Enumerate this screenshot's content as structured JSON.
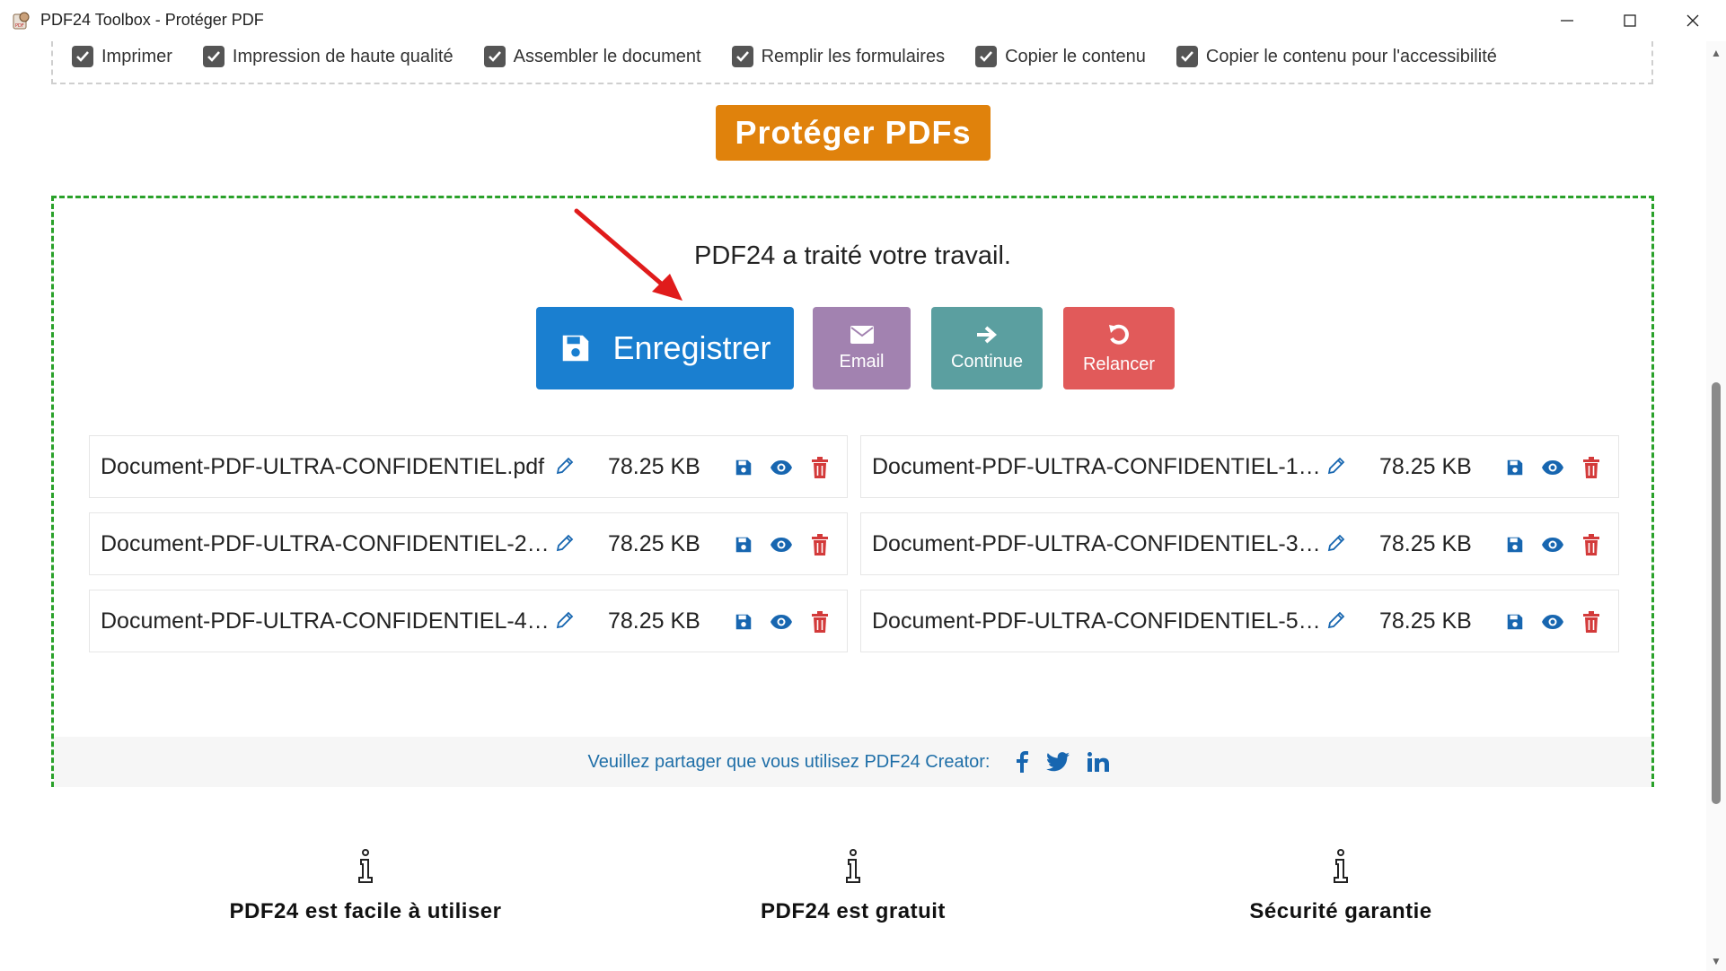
{
  "window": {
    "title": "PDF24 Toolbox - Protéger PDF",
    "icons": {
      "app": "pdf24-app-icon",
      "minimize": "minimize-icon",
      "maximize": "maximize-icon",
      "close": "close-icon"
    }
  },
  "permissions": [
    {
      "label": "Imprimer",
      "checked": true
    },
    {
      "label": "Impression de haute qualité",
      "checked": true
    },
    {
      "label": "Assembler le document",
      "checked": true
    },
    {
      "label": "Remplir les formulaires",
      "checked": true
    },
    {
      "label": "Copier le contenu",
      "checked": true
    },
    {
      "label": "Copier le contenu pour l'accessibilité",
      "checked": true
    }
  ],
  "protect_button": {
    "label": "Protéger PDFs",
    "color": "#e0820c"
  },
  "result": {
    "message": "PDF24 a traité votre travail.",
    "actions": {
      "save": {
        "label": "Enregistrer",
        "icon": "floppy-disk-icon",
        "color": "#1a7fd0"
      },
      "email": {
        "label": "Email",
        "icon": "envelope-icon",
        "color": "#a282b0"
      },
      "continue": {
        "label": "Continue",
        "icon": "arrow-right-icon",
        "color": "#5b9fa0"
      },
      "relancer": {
        "label": "Relancer",
        "icon": "undo-icon",
        "color": "#e15a5a"
      }
    },
    "files": [
      {
        "name": "Document-PDF-ULTRA-CONFIDENTIEL.pdf",
        "size": "78.25 KB"
      },
      {
        "name": "Document-PDF-ULTRA-CONFIDENTIEL-1…",
        "size": "78.25 KB"
      },
      {
        "name": "Document-PDF-ULTRA-CONFIDENTIEL-2…",
        "size": "78.25 KB"
      },
      {
        "name": "Document-PDF-ULTRA-CONFIDENTIEL-3…",
        "size": "78.25 KB"
      },
      {
        "name": "Document-PDF-ULTRA-CONFIDENTIEL-4…",
        "size": "78.25 KB"
      },
      {
        "name": "Document-PDF-ULTRA-CONFIDENTIEL-5…",
        "size": "78.25 KB"
      }
    ],
    "file_icons": {
      "rename": "pencil-icon",
      "save": "floppy-disk-icon",
      "preview": "eye-icon",
      "delete": "trash-icon"
    },
    "share": {
      "text": "Veuillez partager que vous utilisez PDF24 Creator:",
      "networks": [
        "facebook-icon",
        "twitter-icon",
        "linkedin-icon"
      ]
    }
  },
  "features": [
    {
      "title": "PDF24 est facile à utiliser",
      "icon": "info-icon"
    },
    {
      "title": "PDF24 est gratuit",
      "icon": "info-icon"
    },
    {
      "title": "Sécurité garantie",
      "icon": "info-icon"
    }
  ],
  "colors": {
    "accent_green": "#2aa12a",
    "link_blue": "#1f6fa8",
    "icon_blue": "#1766b0",
    "icon_red": "#d33a3a"
  }
}
